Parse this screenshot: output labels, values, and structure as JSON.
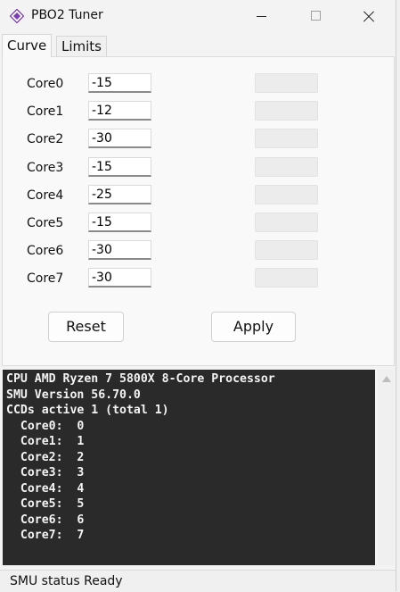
{
  "window": {
    "title": "PBO2 Tuner",
    "icon": "diamond-app-icon"
  },
  "tabs": [
    {
      "label": "Curve",
      "active": true
    },
    {
      "label": "Limits",
      "active": false
    }
  ],
  "cores": [
    {
      "label": "Core0",
      "value": "-15"
    },
    {
      "label": "Core1",
      "value": "-12"
    },
    {
      "label": "Core2",
      "value": "-30"
    },
    {
      "label": "Core3",
      "value": "-15"
    },
    {
      "label": "Core4",
      "value": "-25"
    },
    {
      "label": "Core5",
      "value": "-15"
    },
    {
      "label": "Core6",
      "value": "-30"
    },
    {
      "label": "Core7",
      "value": "-30"
    }
  ],
  "buttons": {
    "reset": "Reset",
    "apply": "Apply"
  },
  "console": {
    "lines": [
      "CPU AMD Ryzen 7 5800X 8-Core Processor",
      "SMU Version 56.70.0",
      "CCDs active 1 (total 1)",
      "  Core0:  0",
      "  Core1:  1",
      "  Core2:  2",
      "  Core3:  3",
      "  Core4:  4",
      "  Core5:  5",
      "  Core6:  6",
      "  Core7:  7"
    ]
  },
  "status": {
    "text": "SMU status Ready"
  },
  "colors": {
    "accent": "#7a3fb0",
    "console_bg": "#2a2a2a",
    "console_fg": "#f4f4f4"
  }
}
